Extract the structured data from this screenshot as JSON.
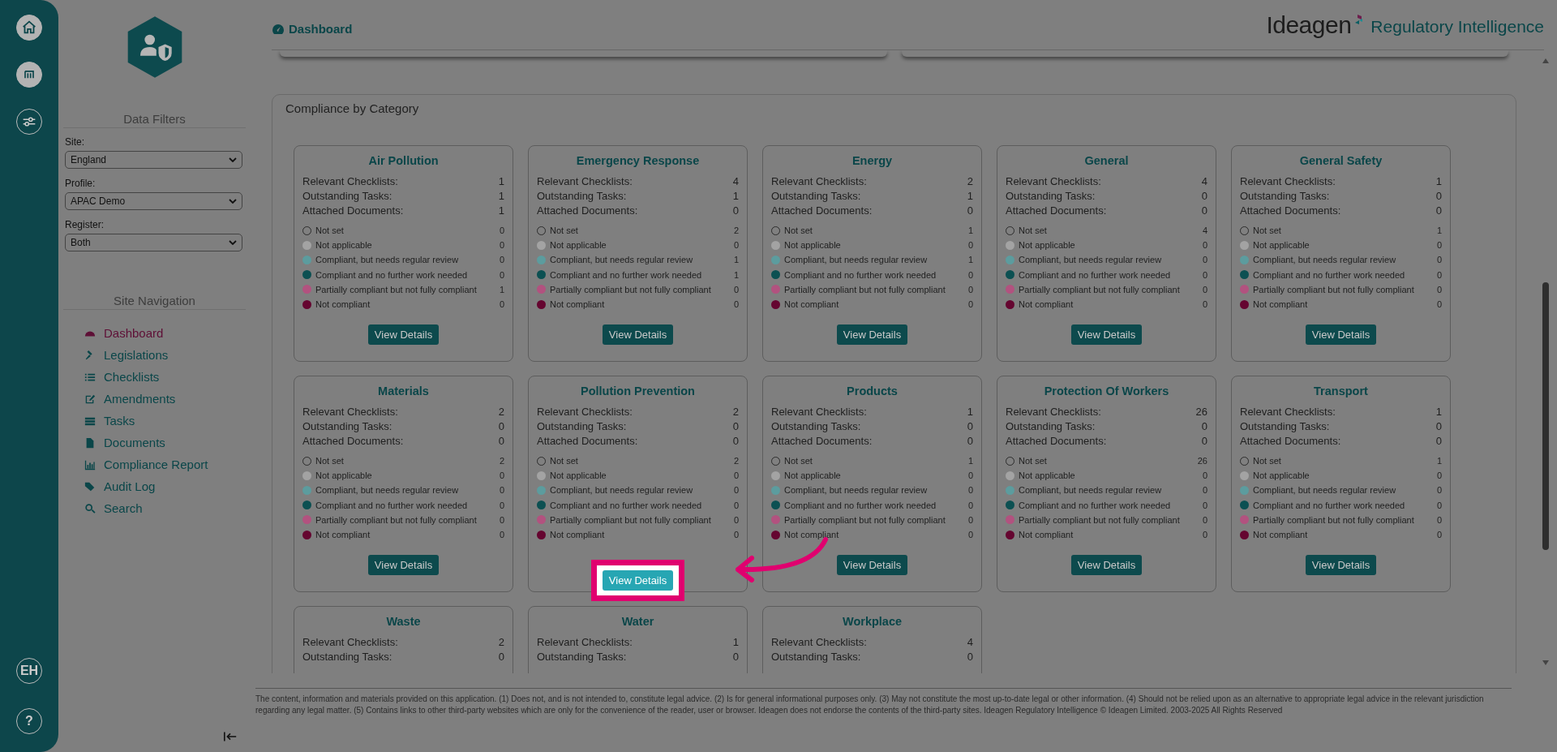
{
  "rail": {
    "avatar": "EH",
    "help": "?"
  },
  "filters": {
    "title": "Data Filters",
    "fields": [
      {
        "label": "Site:",
        "value": "England"
      },
      {
        "label": "Profile:",
        "value": "APAC Demo"
      },
      {
        "label": "Register:",
        "value": "Both"
      }
    ]
  },
  "navigation": {
    "title": "Site Navigation",
    "items": [
      {
        "label": "Dashboard",
        "selected": true
      },
      {
        "label": "Legislations",
        "selected": false
      },
      {
        "label": "Checklists",
        "selected": false
      },
      {
        "label": "Amendments",
        "selected": false
      },
      {
        "label": "Tasks",
        "selected": false
      },
      {
        "label": "Documents",
        "selected": false
      },
      {
        "label": "Compliance Report",
        "selected": false
      },
      {
        "label": "Audit Log",
        "selected": false
      },
      {
        "label": "Search",
        "selected": false
      }
    ]
  },
  "header": {
    "page_title": "Dashboard",
    "brand": "Ideagen",
    "product": "Regulatory Intelligence"
  },
  "panel": {
    "title": "Compliance by Category",
    "cards": [
      {
        "title": "Air Pollution",
        "stats": [
          {
            "label": "Relevant Checklists:",
            "value": "1"
          },
          {
            "label": "Outstanding Tasks:",
            "value": "1"
          },
          {
            "label": "Attached Documents:",
            "value": "1"
          }
        ],
        "statuses": [
          {
            "label": "Not set",
            "count": "0",
            "kind": "outline",
            "color": "#808080"
          },
          {
            "label": "Not applicable",
            "count": "0",
            "kind": "filled",
            "color": "#a3a3a3"
          },
          {
            "label": "Compliant, but needs regular review",
            "count": "0",
            "kind": "filled",
            "color": "#5c9c9e"
          },
          {
            "label": "Compliant and no further work needed",
            "count": "0",
            "kind": "filled",
            "color": "#0c5052"
          },
          {
            "label": "Partially compliant but not fully compliant",
            "count": "1",
            "kind": "filled",
            "color": "#b2527f"
          },
          {
            "label": "Not compliant",
            "count": "0",
            "kind": "filled",
            "color": "#650530"
          }
        ],
        "button": {
          "label": "View Details",
          "highlighted": false
        }
      },
      {
        "title": "Emergency Response",
        "stats": [
          {
            "label": "Relevant Checklists:",
            "value": "4"
          },
          {
            "label": "Outstanding Tasks:",
            "value": "1"
          },
          {
            "label": "Attached Documents:",
            "value": "0"
          }
        ],
        "statuses": [
          {
            "label": "Not set",
            "count": "2",
            "kind": "outline",
            "color": "#808080"
          },
          {
            "label": "Not applicable",
            "count": "0",
            "kind": "filled",
            "color": "#a3a3a3"
          },
          {
            "label": "Compliant, but needs regular review",
            "count": "1",
            "kind": "filled",
            "color": "#5c9c9e"
          },
          {
            "label": "Compliant and no further work needed",
            "count": "1",
            "kind": "filled",
            "color": "#0c5052"
          },
          {
            "label": "Partially compliant but not fully compliant",
            "count": "0",
            "kind": "filled",
            "color": "#b2527f"
          },
          {
            "label": "Not compliant",
            "count": "0",
            "kind": "filled",
            "color": "#650530"
          }
        ],
        "button": {
          "label": "View Details",
          "highlighted": false
        }
      },
      {
        "title": "Energy",
        "stats": [
          {
            "label": "Relevant Checklists:",
            "value": "2"
          },
          {
            "label": "Outstanding Tasks:",
            "value": "1"
          },
          {
            "label": "Attached Documents:",
            "value": "0"
          }
        ],
        "statuses": [
          {
            "label": "Not set",
            "count": "1",
            "kind": "outline",
            "color": "#808080"
          },
          {
            "label": "Not applicable",
            "count": "0",
            "kind": "filled",
            "color": "#a3a3a3"
          },
          {
            "label": "Compliant, but needs regular review",
            "count": "1",
            "kind": "filled",
            "color": "#5c9c9e"
          },
          {
            "label": "Compliant and no further work needed",
            "count": "0",
            "kind": "filled",
            "color": "#0c5052"
          },
          {
            "label": "Partially compliant but not fully compliant",
            "count": "0",
            "kind": "filled",
            "color": "#b2527f"
          },
          {
            "label": "Not compliant",
            "count": "0",
            "kind": "filled",
            "color": "#650530"
          }
        ],
        "button": {
          "label": "View Details",
          "highlighted": false
        }
      },
      {
        "title": "General",
        "stats": [
          {
            "label": "Relevant Checklists:",
            "value": "4"
          },
          {
            "label": "Outstanding Tasks:",
            "value": "0"
          },
          {
            "label": "Attached Documents:",
            "value": "0"
          }
        ],
        "statuses": [
          {
            "label": "Not set",
            "count": "4",
            "kind": "outline",
            "color": "#808080"
          },
          {
            "label": "Not applicable",
            "count": "0",
            "kind": "filled",
            "color": "#a3a3a3"
          },
          {
            "label": "Compliant, but needs regular review",
            "count": "0",
            "kind": "filled",
            "color": "#5c9c9e"
          },
          {
            "label": "Compliant and no further work needed",
            "count": "0",
            "kind": "filled",
            "color": "#0c5052"
          },
          {
            "label": "Partially compliant but not fully compliant",
            "count": "0",
            "kind": "filled",
            "color": "#b2527f"
          },
          {
            "label": "Not compliant",
            "count": "0",
            "kind": "filled",
            "color": "#650530"
          }
        ],
        "button": {
          "label": "View Details",
          "highlighted": false
        }
      },
      {
        "title": "General Safety",
        "stats": [
          {
            "label": "Relevant Checklists:",
            "value": "1"
          },
          {
            "label": "Outstanding Tasks:",
            "value": "0"
          },
          {
            "label": "Attached Documents:",
            "value": "0"
          }
        ],
        "statuses": [
          {
            "label": "Not set",
            "count": "1",
            "kind": "outline",
            "color": "#808080"
          },
          {
            "label": "Not applicable",
            "count": "0",
            "kind": "filled",
            "color": "#a3a3a3"
          },
          {
            "label": "Compliant, but needs regular review",
            "count": "0",
            "kind": "filled",
            "color": "#5c9c9e"
          },
          {
            "label": "Compliant and no further work needed",
            "count": "0",
            "kind": "filled",
            "color": "#0c5052"
          },
          {
            "label": "Partially compliant but not fully compliant",
            "count": "0",
            "kind": "filled",
            "color": "#b2527f"
          },
          {
            "label": "Not compliant",
            "count": "0",
            "kind": "filled",
            "color": "#650530"
          }
        ],
        "button": {
          "label": "View Details",
          "highlighted": false
        }
      },
      {
        "title": "Materials",
        "stats": [
          {
            "label": "Relevant Checklists:",
            "value": "2"
          },
          {
            "label": "Outstanding Tasks:",
            "value": "0"
          },
          {
            "label": "Attached Documents:",
            "value": "0"
          }
        ],
        "statuses": [
          {
            "label": "Not set",
            "count": "2",
            "kind": "outline",
            "color": "#808080"
          },
          {
            "label": "Not applicable",
            "count": "0",
            "kind": "filled",
            "color": "#a3a3a3"
          },
          {
            "label": "Compliant, but needs regular review",
            "count": "0",
            "kind": "filled",
            "color": "#5c9c9e"
          },
          {
            "label": "Compliant and no further work needed",
            "count": "0",
            "kind": "filled",
            "color": "#0c5052"
          },
          {
            "label": "Partially compliant but not fully compliant",
            "count": "0",
            "kind": "filled",
            "color": "#b2527f"
          },
          {
            "label": "Not compliant",
            "count": "0",
            "kind": "filled",
            "color": "#650530"
          }
        ],
        "button": {
          "label": "View Details",
          "highlighted": false
        }
      },
      {
        "title": "Pollution Prevention",
        "stats": [
          {
            "label": "Relevant Checklists:",
            "value": "2"
          },
          {
            "label": "Outstanding Tasks:",
            "value": "0"
          },
          {
            "label": "Attached Documents:",
            "value": "0"
          }
        ],
        "statuses": [
          {
            "label": "Not set",
            "count": "2",
            "kind": "outline",
            "color": "#808080"
          },
          {
            "label": "Not applicable",
            "count": "0",
            "kind": "filled",
            "color": "#a3a3a3"
          },
          {
            "label": "Compliant, but needs regular review",
            "count": "0",
            "kind": "filled",
            "color": "#5c9c9e"
          },
          {
            "label": "Compliant and no further work needed",
            "count": "0",
            "kind": "filled",
            "color": "#0c5052"
          },
          {
            "label": "Partially compliant but not fully compliant",
            "count": "0",
            "kind": "filled",
            "color": "#b2527f"
          },
          {
            "label": "Not compliant",
            "count": "0",
            "kind": "filled",
            "color": "#650530"
          }
        ],
        "button": {
          "label": "View Details",
          "highlighted": true
        }
      },
      {
        "title": "Products",
        "stats": [
          {
            "label": "Relevant Checklists:",
            "value": "1"
          },
          {
            "label": "Outstanding Tasks:",
            "value": "0"
          },
          {
            "label": "Attached Documents:",
            "value": "0"
          }
        ],
        "statuses": [
          {
            "label": "Not set",
            "count": "1",
            "kind": "outline",
            "color": "#808080"
          },
          {
            "label": "Not applicable",
            "count": "0",
            "kind": "filled",
            "color": "#a3a3a3"
          },
          {
            "label": "Compliant, but needs regular review",
            "count": "0",
            "kind": "filled",
            "color": "#5c9c9e"
          },
          {
            "label": "Compliant and no further work needed",
            "count": "0",
            "kind": "filled",
            "color": "#0c5052"
          },
          {
            "label": "Partially compliant but not fully compliant",
            "count": "0",
            "kind": "filled",
            "color": "#b2527f"
          },
          {
            "label": "Not compliant",
            "count": "0",
            "kind": "filled",
            "color": "#650530"
          }
        ],
        "button": {
          "label": "View Details",
          "highlighted": false
        }
      },
      {
        "title": "Protection Of Workers",
        "stats": [
          {
            "label": "Relevant Checklists:",
            "value": "26"
          },
          {
            "label": "Outstanding Tasks:",
            "value": "0"
          },
          {
            "label": "Attached Documents:",
            "value": "0"
          }
        ],
        "statuses": [
          {
            "label": "Not set",
            "count": "26",
            "kind": "outline",
            "color": "#808080"
          },
          {
            "label": "Not applicable",
            "count": "0",
            "kind": "filled",
            "color": "#a3a3a3"
          },
          {
            "label": "Compliant, but needs regular review",
            "count": "0",
            "kind": "filled",
            "color": "#5c9c9e"
          },
          {
            "label": "Compliant and no further work needed",
            "count": "0",
            "kind": "filled",
            "color": "#0c5052"
          },
          {
            "label": "Partially compliant but not fully compliant",
            "count": "0",
            "kind": "filled",
            "color": "#b2527f"
          },
          {
            "label": "Not compliant",
            "count": "0",
            "kind": "filled",
            "color": "#650530"
          }
        ],
        "button": {
          "label": "View Details",
          "highlighted": false
        }
      },
      {
        "title": "Transport",
        "stats": [
          {
            "label": "Relevant Checklists:",
            "value": "1"
          },
          {
            "label": "Outstanding Tasks:",
            "value": "0"
          },
          {
            "label": "Attached Documents:",
            "value": "0"
          }
        ],
        "statuses": [
          {
            "label": "Not set",
            "count": "1",
            "kind": "outline",
            "color": "#808080"
          },
          {
            "label": "Not applicable",
            "count": "0",
            "kind": "filled",
            "color": "#a3a3a3"
          },
          {
            "label": "Compliant, but needs regular review",
            "count": "0",
            "kind": "filled",
            "color": "#5c9c9e"
          },
          {
            "label": "Compliant and no further work needed",
            "count": "0",
            "kind": "filled",
            "color": "#0c5052"
          },
          {
            "label": "Partially compliant but not fully compliant",
            "count": "0",
            "kind": "filled",
            "color": "#b2527f"
          },
          {
            "label": "Not compliant",
            "count": "0",
            "kind": "filled",
            "color": "#650530"
          }
        ],
        "button": {
          "label": "View Details",
          "highlighted": false
        }
      },
      {
        "title": "Waste",
        "stats": [
          {
            "label": "Relevant Checklists:",
            "value": "2"
          },
          {
            "label": "Outstanding Tasks:",
            "value": "0"
          }
        ]
      },
      {
        "title": "Water",
        "stats": [
          {
            "label": "Relevant Checklists:",
            "value": "1"
          },
          {
            "label": "Outstanding Tasks:",
            "value": "0"
          }
        ]
      },
      {
        "title": "Workplace",
        "stats": [
          {
            "label": "Relevant Checklists:",
            "value": "4"
          },
          {
            "label": "Outstanding Tasks:",
            "value": "0"
          }
        ]
      }
    ]
  },
  "footer": "The content, information and materials provided on this application. (1) Does not, and is not intended to, constitute legal advice. (2) Is for general informational purposes only. (3) May not constitute the most up-to-date legal or other information. (4) Should not be relied upon as an alternative to appropriate legal advice in the relevant jurisdiction regarding any legal matter. (5) Contains links to other third-party websites which are only for the convenience of the reader, user or browser. Ideagen does not endorse the contents of the third-party sites. Ideagen Regulatory Intelligence © Ideagen Limited. 2003-2025 All Rights Reserved"
}
